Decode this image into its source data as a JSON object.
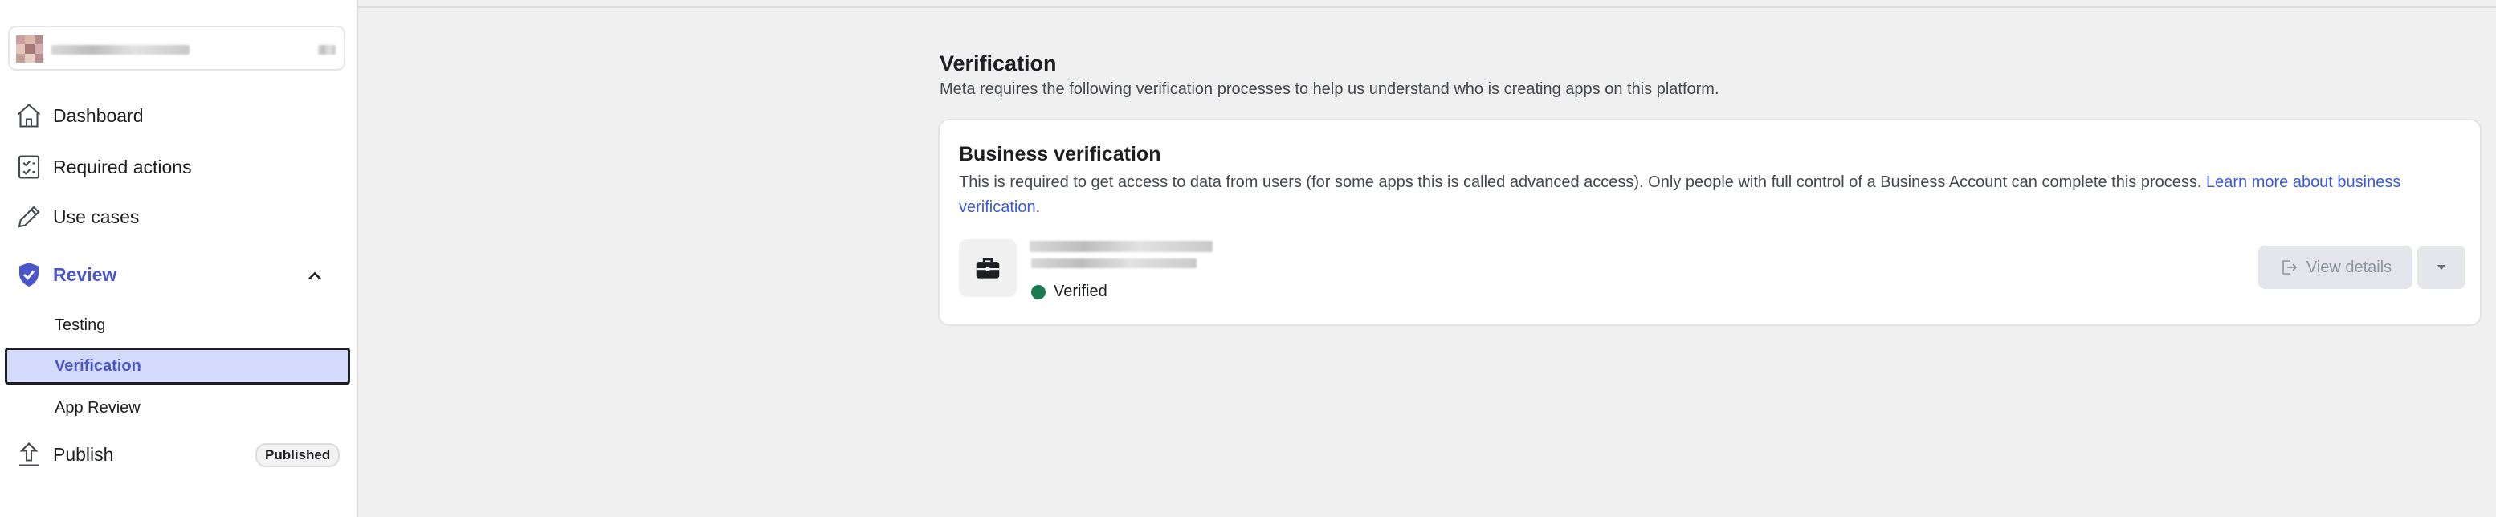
{
  "sidebar": {
    "nav": [
      {
        "label": "Dashboard",
        "icon": "home-icon"
      },
      {
        "label": "Required actions",
        "icon": "checklist-icon"
      },
      {
        "label": "Use cases",
        "icon": "pencil-icon"
      },
      {
        "label": "Review",
        "icon": "shield-check-icon"
      },
      {
        "label": "Publish",
        "icon": "upload-icon"
      }
    ],
    "review_sub": [
      {
        "label": "Testing"
      },
      {
        "label": "Verification"
      },
      {
        "label": "App Review"
      }
    ],
    "publish_badge": "Published"
  },
  "main": {
    "title": "Verification",
    "description": "Meta requires the following verification processes to help us understand who is creating apps on this platform.",
    "card": {
      "title": "Business verification",
      "description": "This is required to get access to data from users (for some apps this is called advanced access). Only people with full control of a Business Account can complete this process.",
      "link_text": "Learn more about business verification",
      "link_suffix": ".",
      "status": "Verified",
      "view_details_label": "View details"
    }
  },
  "colors": {
    "accent": "#4a55c8",
    "selected_bg": "#d4dbfa",
    "verified": "#1b7a4f",
    "link": "#3b5bdb"
  }
}
